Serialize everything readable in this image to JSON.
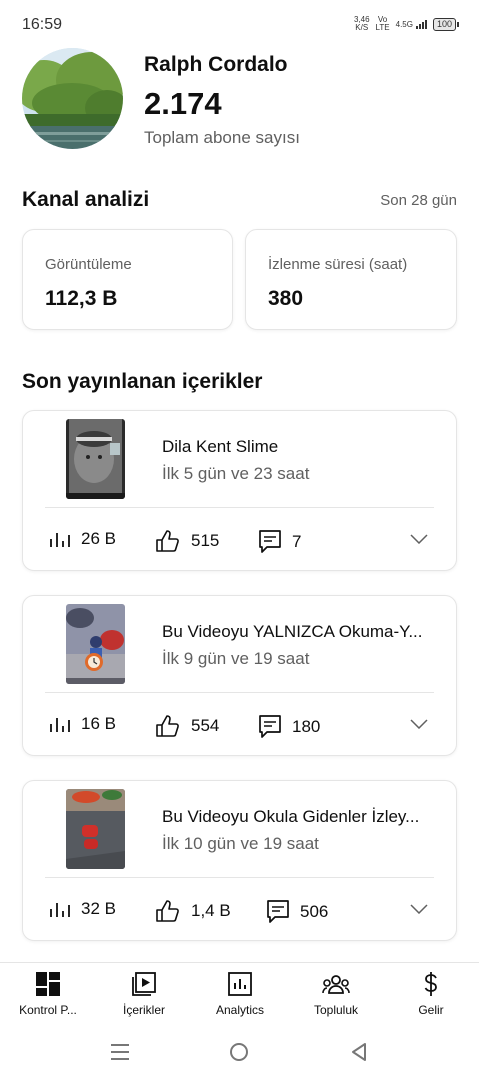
{
  "status_bar": {
    "time": "16:59",
    "speed_value": "3,46",
    "speed_unit": "K/S",
    "volte_top": "Vo",
    "volte_bottom": "LTE",
    "network": "4.5G",
    "battery": "100"
  },
  "channel": {
    "name": "Ralph Cordalo",
    "subscriber_count": "2.174",
    "subscriber_label": "Toplam abone sayısı"
  },
  "analytics": {
    "title": "Kanal analizi",
    "range": "Son 28 gün",
    "views_label": "Görüntüleme",
    "views_value": "112,3 B",
    "watch_label": "İzlenme süresi (saat)",
    "watch_value": "380"
  },
  "recent": {
    "title": "Son yayınlanan içerikler",
    "items": [
      {
        "title": "Dila Kent Slime",
        "age": "İlk 5 gün ve 23 saat",
        "views": "26 B",
        "likes": "515",
        "comments": "7"
      },
      {
        "title": "Bu Videoyu YALNIZCA Okuma-Y...",
        "age": "İlk 9 gün ve 19 saat",
        "views": "16 B",
        "likes": "554",
        "comments": "180"
      },
      {
        "title": "Bu Videoyu Okula Gidenler İzley...",
        "age": "İlk 10 gün ve 19 saat",
        "views": "32 B",
        "likes": "1,4 B",
        "comments": "506"
      }
    ]
  },
  "bottom_nav": [
    {
      "label": "Kontrol P...",
      "icon": "dashboard-icon"
    },
    {
      "label": "İçerikler",
      "icon": "content-icon"
    },
    {
      "label": "Analytics",
      "icon": "analytics-icon"
    },
    {
      "label": "Topluluk",
      "icon": "community-icon"
    },
    {
      "label": "Gelir",
      "icon": "earn-icon"
    }
  ],
  "colors": {
    "text": "#0f0f0f",
    "secondary": "#606060",
    "divider": "#e5e5e5"
  }
}
